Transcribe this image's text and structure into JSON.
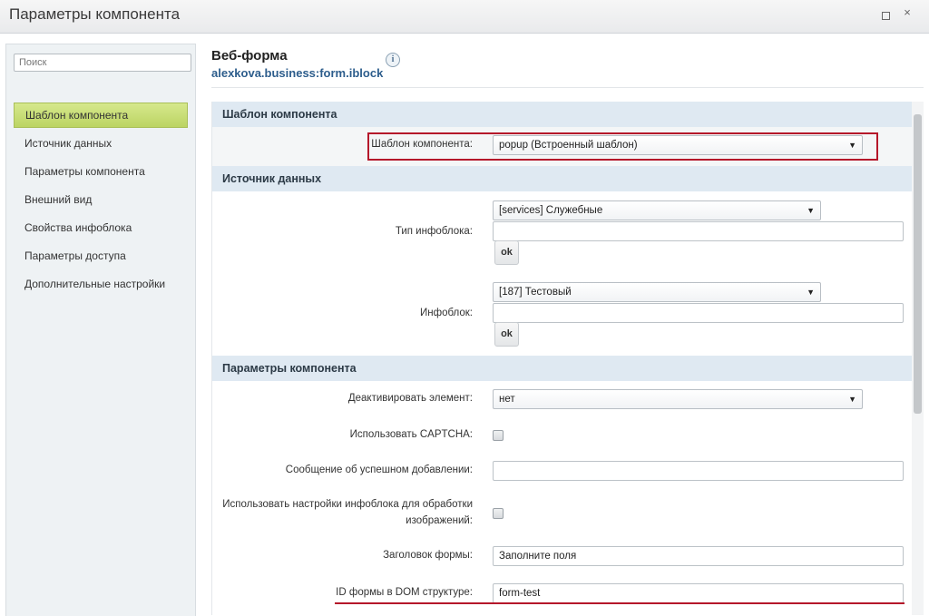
{
  "window": {
    "title": "Параметры компонента",
    "maximize_icon": "maximize-icon",
    "close_glyph": "×"
  },
  "sidebar": {
    "search_placeholder": "Поиск",
    "items": [
      {
        "label": "Шаблон компонента",
        "active": true
      },
      {
        "label": "Источник данных"
      },
      {
        "label": "Параметры компонента"
      },
      {
        "label": "Внешний вид"
      },
      {
        "label": "Свойства инфоблока"
      },
      {
        "label": "Параметры доступа"
      },
      {
        "label": "Дополнительные настройки"
      }
    ]
  },
  "header": {
    "title": "Веб-форма",
    "subtitle": "alexkova.business:form.iblock",
    "info_icon": "i"
  },
  "sections": {
    "template": {
      "title": "Шаблон компонента",
      "template_label": "Шаблон компонента:",
      "template_value": "popup (Встроенный шаблон)"
    },
    "datasource": {
      "title": "Источник данных",
      "iblock_type_label": "Тип инфоблока:",
      "iblock_type_value": "[services] Служебные",
      "iblock_label": "Инфоблок:",
      "iblock_value": "[187] Тестовый",
      "ok_label": "ok"
    },
    "params": {
      "title": "Параметры компонента",
      "deactivate_label": "Деактивировать элемент:",
      "deactivate_value": "нет",
      "captcha_label": "Использовать CAPTCHA:",
      "success_msg_label": "Сообщение об успешном добавлении:",
      "success_msg_value": "",
      "use_iblock_settings_label_1": "Использовать настройки инфоблока для обработки",
      "use_iblock_settings_label_2": "изображений:",
      "form_title_label": "Заголовок формы:",
      "form_title_value": "Заполните поля",
      "form_id_label": "ID формы в DOM структуре:",
      "form_id_value": "form-test"
    }
  },
  "colors": {
    "accent_active": "#c6dc74",
    "section_bg": "#dfe9f2",
    "highlight_red": "#b5172a",
    "link_blue": "#2d5d8c"
  }
}
